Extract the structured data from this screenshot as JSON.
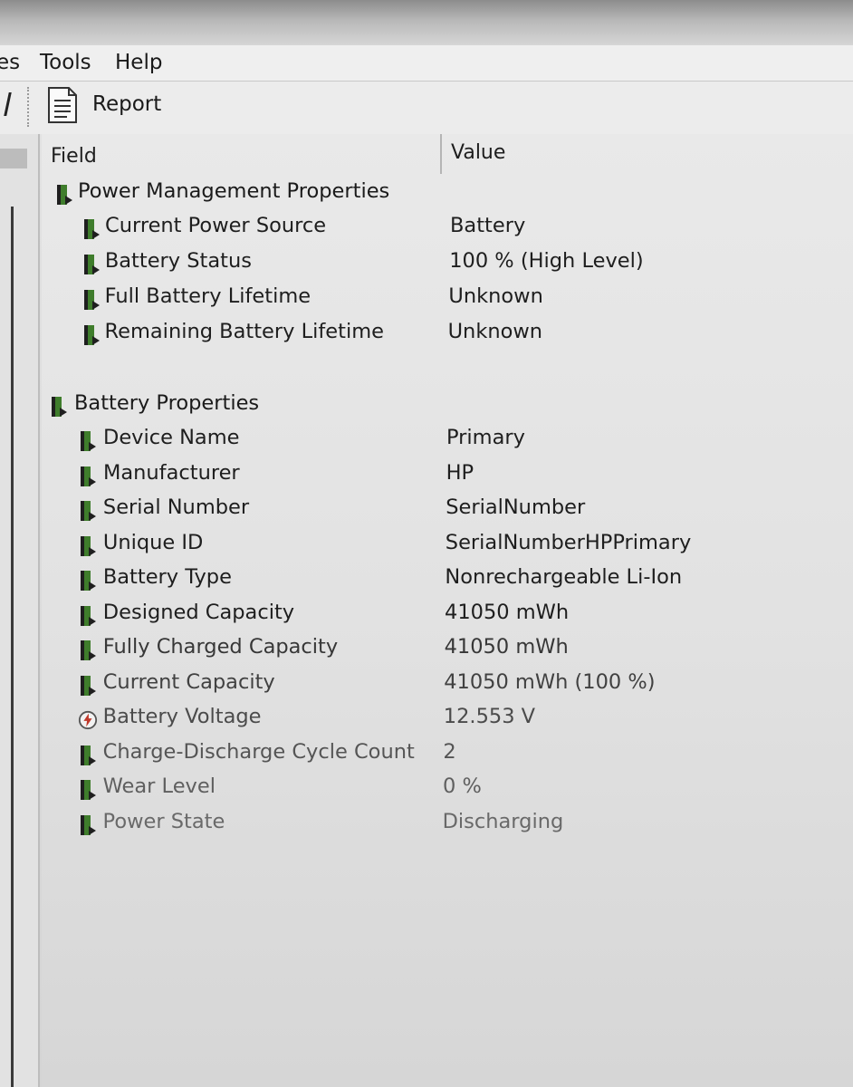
{
  "menubar": {
    "partial_item": "es",
    "items": [
      "Tools",
      "Help"
    ]
  },
  "toolbar": {
    "report_label": "Report"
  },
  "list": {
    "columns": {
      "field": "Field",
      "value": "Value"
    },
    "groups": [
      {
        "title": "Power Management Properties",
        "icon": "battery-icon",
        "rows": [
          {
            "field": "Current Power Source",
            "value": "Battery",
            "icon": "battery-icon"
          },
          {
            "field": "Battery Status",
            "value": "100 % (High Level)",
            "icon": "battery-icon"
          },
          {
            "field": "Full Battery Lifetime",
            "value": "Unknown",
            "icon": "battery-icon"
          },
          {
            "field": "Remaining Battery Lifetime",
            "value": "Unknown",
            "icon": "battery-icon"
          }
        ]
      },
      {
        "title": "Battery Properties",
        "icon": "battery-icon",
        "rows": [
          {
            "field": "Device Name",
            "value": "Primary",
            "icon": "battery-icon"
          },
          {
            "field": "Manufacturer",
            "value": "HP",
            "icon": "battery-icon"
          },
          {
            "field": "Serial Number",
            "value": "SerialNumber",
            "icon": "battery-icon"
          },
          {
            "field": "Unique ID",
            "value": "SerialNumberHPPrimary",
            "icon": "battery-icon"
          },
          {
            "field": "Battery Type",
            "value": "Nonrechargeable Li-Ion",
            "icon": "battery-icon"
          },
          {
            "field": "Designed Capacity",
            "value": "41050 mWh",
            "icon": "battery-icon"
          },
          {
            "field": "Fully Charged Capacity",
            "value": "41050 mWh",
            "icon": "battery-icon"
          },
          {
            "field": "Current Capacity",
            "value": "41050 mWh  (100 %)",
            "icon": "battery-icon"
          },
          {
            "field": "Battery Voltage",
            "value": "12.553 V",
            "icon": "voltage-icon"
          },
          {
            "field": "Charge-Discharge Cycle Count",
            "value": "2",
            "icon": "battery-icon"
          },
          {
            "field": "Wear Level",
            "value": "0 %",
            "icon": "battery-icon"
          },
          {
            "field": "Power State",
            "value": "Discharging",
            "icon": "battery-icon"
          }
        ]
      }
    ]
  },
  "colors": {
    "battery_green": "#3f7d2c",
    "text": "#1e1e1e",
    "faded_text": "#7a7a7a"
  }
}
